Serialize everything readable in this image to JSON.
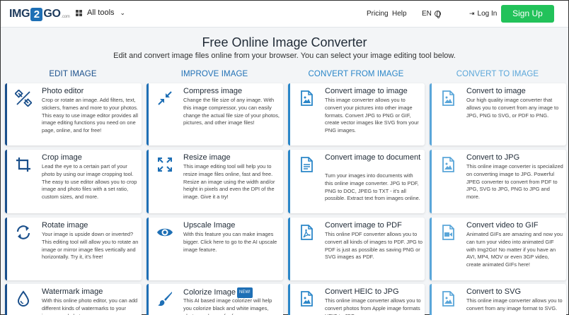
{
  "header": {
    "logo_left": "IMG",
    "logo_mid": "2",
    "logo_right": "GO",
    "logo_suffix": ".com",
    "all_tools": "All tools",
    "pricing": "Pricing",
    "help": "Help",
    "language": "EN",
    "login": "Log In",
    "signup": "Sign Up"
  },
  "hero": {
    "title": "Free Online Image Converter",
    "subtitle": "Edit and convert image files online from your browser. You can select your image editing tool below."
  },
  "columns": [
    {
      "heading": "EDIT IMAGE",
      "color": "#1a4f8b"
    },
    {
      "heading": "IMPROVE IMAGE",
      "color": "#1e6fb5"
    },
    {
      "heading": "CONVERT FROM IMAGE",
      "color": "#2a86c8"
    },
    {
      "heading": "CONVERT TO IMAGE",
      "color": "#5aa6d9"
    }
  ],
  "cards": {
    "c0r0": {
      "title": "Photo editor",
      "desc": "Crop or rotate an image. Add filters, text, stickers, frames and more to your photos. This easy to use image editor provides all image editing functions you need on one page, online, and for free!"
    },
    "c0r1": {
      "title": "Crop image",
      "desc": "Lead the eye to a certain part of your photo by using our image cropping tool. The easy to use editor allows you to crop image and photo files with a set ratio, custom sizes, and more."
    },
    "c0r2": {
      "title": "Rotate image",
      "desc": "Your image is upside down or inverted? This editing tool will allow you to rotate an image or mirror image files vertically and horizontally. Try it, it's free!"
    },
    "c0r3": {
      "title": "Watermark image",
      "desc": "With this online photo editor, you can add different kinds of watermarks to your images and photos."
    },
    "c1r0": {
      "title": "Compress image",
      "desc": "Change the file size of any image. With this image compressor, you can easily change the actual file size of your photos, pictures, and other image files!"
    },
    "c1r1": {
      "title": "Resize image",
      "desc": "This image editing tool will help you to resize image files online, fast and free. Resize an image using the width and/or height in pixels and even the DPI of the image. Give it a try!"
    },
    "c1r2": {
      "title": "Upscale Image",
      "desc": "With this feature you can make images bigger. Click here to go to the AI upscale image feature."
    },
    "c1r3": {
      "title": "Colorize Image",
      "badge": "NEW!",
      "desc": "This AI based image colorizer will help you colorize black and white images, photos and more for free."
    },
    "c2r0": {
      "title": "Convert image to image",
      "desc": "This image converter allows you to convert your pictures into other image formats. Convert JPG to PNG or GIF, create vector images like SVG from your PNG images."
    },
    "c2r1": {
      "title": "Convert image to document",
      "desc": "Turn your images into documents with this online image converter. JPG to PDF, PNG to DOC, JPEG to TXT - it's all possible. Extract text from images online."
    },
    "c2r2": {
      "title": "Convert image to PDF",
      "desc": "This online PDF converter allows you to convert all kinds of images to PDF. JPG to PDF is just as possible as saving PNG or SVG images as PDF."
    },
    "c2r3": {
      "title": "Convert HEIC to JPG",
      "desc": "This online image converter allows you to convert photos from Apple image formats HEIC to JPG."
    },
    "c3r0": {
      "title": "Convert to image",
      "desc": "Our high quality image converter that allows you to convert from any image to JPG, PNG to SVG, or PDF to PNG."
    },
    "c3r1": {
      "title": "Convert to JPG",
      "desc": "This online image converter is specialized on converting image to JPG. Powerful JPEG converter to convert from PDF to JPG, SVG to JPG, PNG to JPG and more."
    },
    "c3r2": {
      "title": "Convert video to GIF",
      "desc": "Animated GIFs are amazing and now you can turn your video into animated GIF with Img2Go! No matter if you have an AVI, MP4, MOV or even 3GP video, create animated GIFs here!"
    },
    "c3r3": {
      "title": "Convert to SVG",
      "desc": "This online image converter allows you to convert from any image format to SVG."
    }
  },
  "colors": {
    "accent": "#1e6fb5",
    "signup": "#22c25a"
  }
}
